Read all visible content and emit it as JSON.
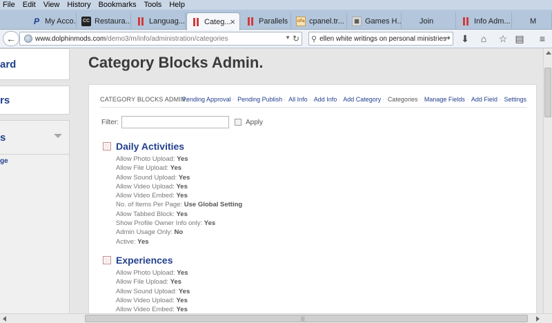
{
  "menubar": {
    "items": [
      "File",
      "Edit",
      "View",
      "History",
      "Bookmarks",
      "Tools",
      "Help"
    ]
  },
  "tabs": [
    {
      "label": "My Acco...",
      "icon": "paypal-icon"
    },
    {
      "label": "Restaura...",
      "icon": "cc-icon"
    },
    {
      "label": "Languag...",
      "icon": "parallels-icon"
    },
    {
      "label": "Categ...",
      "icon": "parallels-icon",
      "active": true
    },
    {
      "label": "Parallels ...",
      "icon": "parallels-icon"
    },
    {
      "label": "cpanel.tr...",
      "icon": "cpanel-icon"
    },
    {
      "label": "Games H...",
      "icon": "games-icon"
    },
    {
      "label": "Join",
      "icon": "blank-icon"
    },
    {
      "label": "Info Adm...",
      "icon": "parallels-icon"
    },
    {
      "label": "M",
      "icon": "blank-icon"
    }
  ],
  "navbar": {
    "url_host": "www.dolphinmods.com",
    "url_path": "/demo3/m/info/administration/categories",
    "search_value": "ellen white writings on personal ministries"
  },
  "sidebar": {
    "items": [
      {
        "label": "ard"
      },
      {
        "label": "rs"
      },
      {
        "label": "s"
      }
    ],
    "sub_item": "ge"
  },
  "page": {
    "title": "Category Blocks Admin."
  },
  "panel": {
    "title": "CATEGORY BLOCKS ADMIN.",
    "links": [
      "Pending Approval",
      "Pending Publish",
      "All Info",
      "Add Info",
      "Add Category",
      "Categories",
      "Manage Fields",
      "Add Field",
      "Settings"
    ],
    "separator": "·",
    "filter_label": "Filter:",
    "filter_value": "",
    "apply_label": "Apply"
  },
  "categories": [
    {
      "name": "Daily Activities",
      "rows": [
        {
          "label": "Allow Photo Upload:",
          "value": "Yes"
        },
        {
          "label": "Allow File Upload:",
          "value": "Yes"
        },
        {
          "label": "Allow Sound Upload:",
          "value": "Yes"
        },
        {
          "label": "Allow Video Upload:",
          "value": "Yes"
        },
        {
          "label": "Allow Video Embed:",
          "value": "Yes"
        },
        {
          "label": "No. of Items Per Page:",
          "value": "Use Global Setting"
        },
        {
          "label": "Allow Tabbed Block:",
          "value": "Yes"
        },
        {
          "label": "Show Profile Owner Info only:",
          "value": "Yes"
        },
        {
          "label": "Admin Usage Only:",
          "value": "No"
        },
        {
          "label": "Active:",
          "value": "Yes"
        }
      ]
    },
    {
      "name": "Experiences",
      "rows": [
        {
          "label": "Allow Photo Upload:",
          "value": "Yes"
        },
        {
          "label": "Allow File Upload:",
          "value": "Yes"
        },
        {
          "label": "Allow Sound Upload:",
          "value": "Yes"
        },
        {
          "label": "Allow Video Upload:",
          "value": "Yes"
        },
        {
          "label": "Allow Video Embed:",
          "value": "Yes"
        }
      ]
    }
  ],
  "colors": {
    "link": "#23408e",
    "tabstrip": "#b3c6dc",
    "menubar": "#c9d6e6"
  }
}
